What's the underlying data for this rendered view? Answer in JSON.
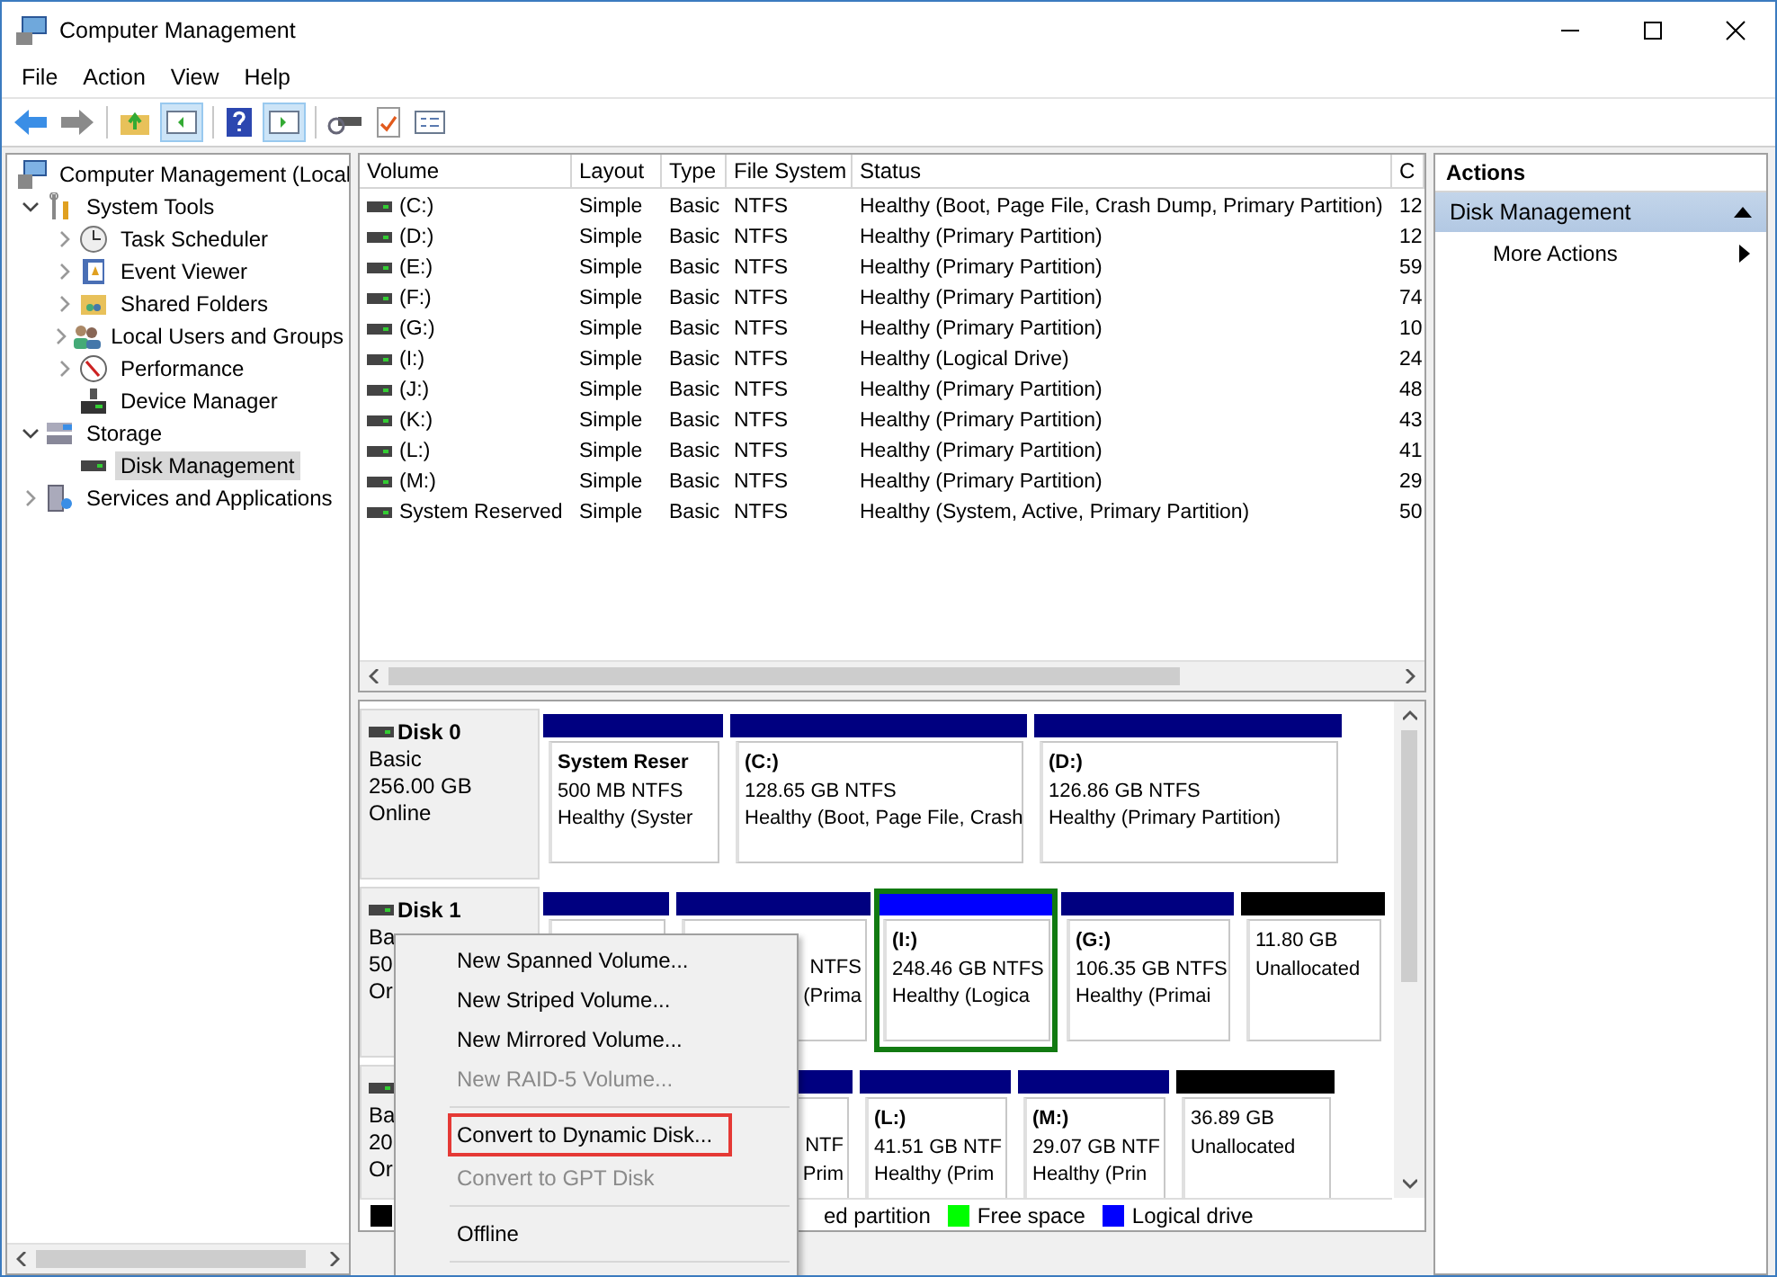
{
  "window": {
    "title": "Computer Management"
  },
  "menu": [
    {
      "label": "File"
    },
    {
      "label": "Action"
    },
    {
      "label": "View"
    },
    {
      "label": "Help"
    }
  ],
  "tree": {
    "label": "Computer Management (Local",
    "selected": false,
    "children": [
      {
        "label": "System Tools",
        "selected": false,
        "expanded": true,
        "children": [
          {
            "label": "Task Scheduler",
            "selected": false,
            "expanded": false
          },
          {
            "label": "Event Viewer",
            "selected": false,
            "expanded": false
          },
          {
            "label": "Shared Folders",
            "selected": false,
            "expanded": false
          },
          {
            "label": "Local Users and Groups",
            "selected": false,
            "expanded": false
          },
          {
            "label": "Performance",
            "selected": false,
            "expanded": false
          },
          {
            "label": "Device Manager",
            "selected": false
          }
        ]
      },
      {
        "label": "Storage",
        "selected": false,
        "expanded": true,
        "children": [
          {
            "label": "Disk Management",
            "selected": true
          }
        ]
      },
      {
        "label": "Services and Applications",
        "selected": false,
        "expanded": false
      }
    ]
  },
  "volumes": {
    "columns": [
      "Volume",
      "Layout",
      "Type",
      "File System",
      "Status",
      "C"
    ],
    "rows": [
      [
        "(C:)",
        "Simple",
        "Basic",
        "NTFS",
        "Healthy (Boot, Page File, Crash Dump, Primary Partition)",
        "12"
      ],
      [
        "(D:)",
        "Simple",
        "Basic",
        "NTFS",
        "Healthy (Primary Partition)",
        "12"
      ],
      [
        "(E:)",
        "Simple",
        "Basic",
        "NTFS",
        "Healthy (Primary Partition)",
        "59"
      ],
      [
        "(F:)",
        "Simple",
        "Basic",
        "NTFS",
        "Healthy (Primary Partition)",
        "74"
      ],
      [
        "(G:)",
        "Simple",
        "Basic",
        "NTFS",
        "Healthy (Primary Partition)",
        "10"
      ],
      [
        "(I:)",
        "Simple",
        "Basic",
        "NTFS",
        "Healthy (Logical Drive)",
        "24"
      ],
      [
        "(J:)",
        "Simple",
        "Basic",
        "NTFS",
        "Healthy (Primary Partition)",
        "48"
      ],
      [
        "(K:)",
        "Simple",
        "Basic",
        "NTFS",
        "Healthy (Primary Partition)",
        "43"
      ],
      [
        "(L:)",
        "Simple",
        "Basic",
        "NTFS",
        "Healthy (Primary Partition)",
        "41"
      ],
      [
        "(M:)",
        "Simple",
        "Basic",
        "NTFS",
        "Healthy (Primary Partition)",
        "29"
      ],
      [
        "System Reserved",
        "Simple",
        "Basic",
        "NTFS",
        "Healthy (System, Active, Primary Partition)",
        "50"
      ]
    ]
  },
  "disks": [
    {
      "name": "Disk 0",
      "info": [
        "Basic",
        "256.00 GB",
        "Online"
      ],
      "partitions": [
        {
          "kind": "primary",
          "selected": false,
          "lines": [
            "System Reser",
            "500 MB NTFS",
            "Healthy (Syster"
          ]
        },
        {
          "kind": "primary",
          "selected": false,
          "lines": [
            "(C:)",
            "128.65 GB NTFS",
            "Healthy (Boot, Page File, Crash"
          ]
        },
        {
          "kind": "primary",
          "selected": false,
          "lines": [
            "(D:)",
            "126.86 GB NTFS",
            "Healthy (Primary Partition)"
          ]
        }
      ]
    },
    {
      "name": "Disk 1",
      "info": [
        "Ba",
        "50",
        "Or"
      ],
      "partitions": [
        {
          "kind": "primary",
          "selected": false
        },
        {
          "kind": "primary",
          "selected": false,
          "lines": [
            "NTFS",
            "(Prima"
          ]
        },
        {
          "kind": "logical",
          "selected": true,
          "lines": [
            "(I:)",
            "248.46 GB NTFS",
            "Healthy (Logica"
          ]
        },
        {
          "kind": "primary",
          "selected": false,
          "lines": [
            "(G:)",
            "106.35 GB NTFS",
            "Healthy (Primai"
          ]
        },
        {
          "kind": "unallocated",
          "selected": false,
          "lines": [
            "11.80 GB",
            "Unallocated"
          ]
        }
      ]
    },
    {
      "info": [
        "Ba",
        "20",
        "Or"
      ],
      "partitions": [
        {
          "kind": "primary",
          "selected": false,
          "lines": [
            "NTF",
            "Prim"
          ]
        },
        {
          "kind": "primary",
          "selected": false,
          "lines": [
            "(L:)",
            "41.51 GB NTF",
            "Healthy (Prim"
          ]
        },
        {
          "kind": "primary",
          "selected": false,
          "lines": [
            "(M:)",
            "29.07 GB NTF",
            "Healthy (Prin"
          ]
        },
        {
          "kind": "unallocated",
          "selected": false,
          "lines": [
            "36.89 GB",
            "Unallocated"
          ]
        }
      ]
    }
  ],
  "legend": [
    {
      "label": "ed partition",
      "color": "#000000"
    },
    {
      "label": "Free space",
      "color": "#00ff00"
    },
    {
      "label": "Logical drive",
      "color": "#0000ff"
    }
  ],
  "actions": {
    "title": "Actions",
    "section": {
      "label": "Disk Management",
      "expanded": true
    },
    "items": [
      {
        "label": "More Actions"
      }
    ]
  },
  "context_menu": [
    {
      "kind": "item",
      "label": "New Spanned Volume...",
      "disabled": false,
      "highlighted": false
    },
    {
      "kind": "item",
      "label": "New Striped Volume...",
      "disabled": false,
      "highlighted": false
    },
    {
      "kind": "item",
      "label": "New Mirrored Volume...",
      "disabled": false,
      "highlighted": false
    },
    {
      "kind": "item",
      "label": "New RAID-5 Volume...",
      "disabled": true,
      "highlighted": false
    },
    {
      "kind": "separator"
    },
    {
      "kind": "item",
      "label": "Convert to Dynamic Disk...",
      "disabled": false,
      "highlighted": true
    },
    {
      "kind": "item",
      "label": "Convert to GPT Disk",
      "disabled": true,
      "highlighted": false
    },
    {
      "kind": "separator"
    },
    {
      "kind": "item",
      "label": "Offline",
      "disabled": false,
      "highlighted": false
    },
    {
      "kind": "separator"
    }
  ]
}
